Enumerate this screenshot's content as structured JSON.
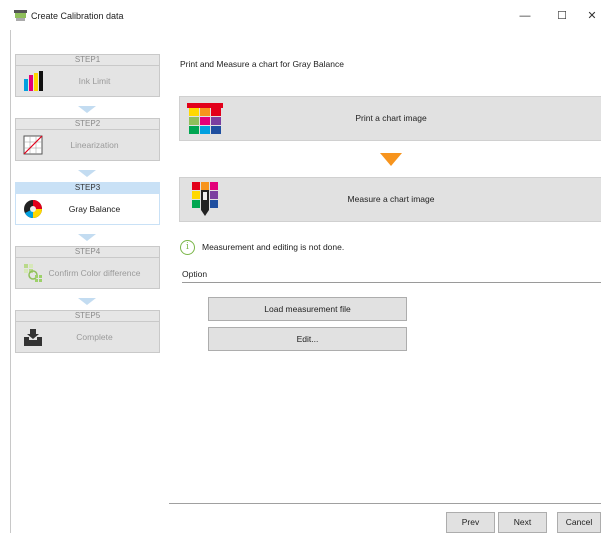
{
  "window": {
    "title": "Create Calibration data",
    "minimize": "—",
    "maximize": "☐",
    "close": "✕"
  },
  "steps": [
    {
      "header": "STEP1",
      "label": "Ink Limit",
      "icon": "ink-bars-icon",
      "active": false
    },
    {
      "header": "STEP2",
      "label": "Linearization",
      "icon": "linearization-graph-icon",
      "active": false
    },
    {
      "header": "STEP3",
      "label": "Gray Balance",
      "icon": "color-wheel-icon",
      "active": true
    },
    {
      "header": "STEP4",
      "label": "Confirm Color difference",
      "icon": "color-patch-magnifier-icon",
      "active": false
    },
    {
      "header": "STEP5",
      "label": "Complete",
      "icon": "tray-download-icon",
      "active": false
    }
  ],
  "main": {
    "heading": "Print and Measure a chart for Gray Balance",
    "print_button": "Print a chart image",
    "measure_button": "Measure a chart image",
    "status_icon": "i",
    "status_text": "Measurement and editing is not done.",
    "option_label": "Option",
    "load_button": "Load measurement file",
    "edit_button": "Edit..."
  },
  "footer": {
    "prev": "Prev",
    "next": "Next",
    "cancel": "Cancel"
  },
  "colors": {
    "accent_step": "#c9e1f6",
    "arrow": "#f7941d",
    "status_ok": "#7ab648"
  }
}
